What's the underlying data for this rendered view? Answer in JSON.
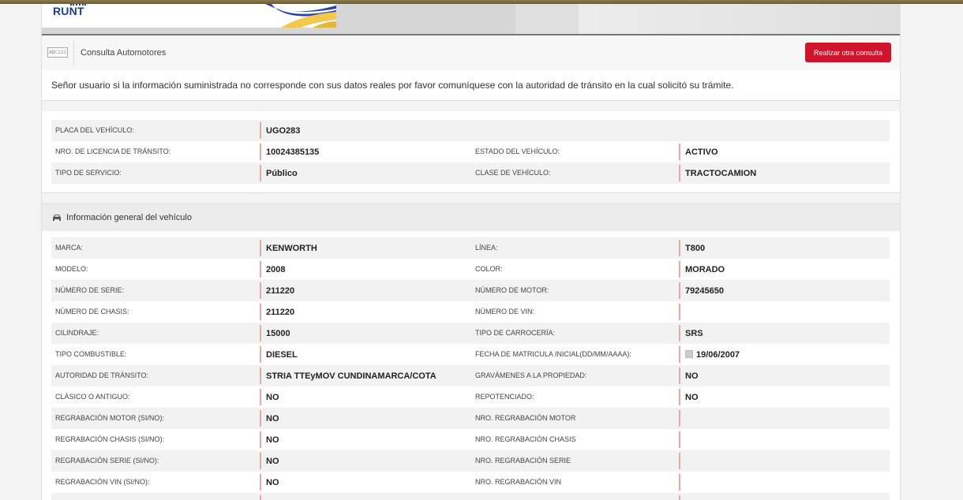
{
  "header": {
    "logo_text": "RUNT",
    "module_title": "Consulta Automotores",
    "plate_icon_text": "ABC123",
    "action_button": "Realizar otra consulta"
  },
  "notice": "Señor usuario si la información suministrada no corresponde con sus datos reales por favor comuníquese con la autoridad de tránsito en la cual solicitó su trámite.",
  "summary": {
    "rows": [
      {
        "label1": "PLACA DEL VEHÍCULO:",
        "value1": "UGO283",
        "label2": "",
        "value2": ""
      },
      {
        "label1": "NRO. DE LICENCIA DE TRÁNSITO:",
        "value1": "10024385135",
        "label2": "ESTADO DEL VEHÍCULO:",
        "value2": "ACTIVO"
      },
      {
        "label1": "TIPO DE SERVICIO:",
        "value1": "Público",
        "label2": "CLASE DE VEHÍCULO:",
        "value2": "TRACTOCAMION"
      }
    ]
  },
  "general": {
    "title": "Información general del vehículo",
    "icon": "car-icon",
    "rows": [
      {
        "label1": "MARCA:",
        "value1": "KENWORTH",
        "label2": "LÍNEA:",
        "value2": "T800"
      },
      {
        "label1": "MODELO:",
        "value1": "2008",
        "label2": "COLOR:",
        "value2": "MORADO"
      },
      {
        "label1": "NÚMERO DE SERIE:",
        "value1": "211220",
        "label2": "NÚMERO DE MOTOR:",
        "value2": "79245650"
      },
      {
        "label1": "NÚMERO DE CHASIS:",
        "value1": "211220",
        "label2": "NÚMERO DE VIN:",
        "value2": ""
      },
      {
        "label1": "CILINDRAJE:",
        "value1": "15000",
        "label2": "TIPO DE CARROCERÍA:",
        "value2": "SRS"
      },
      {
        "label1": "TIPO COMBUSTIBLE:",
        "value1": "DIESEL",
        "label2": "FECHA DE MATRICULA INICIAL(DD/MM/AAAA):",
        "value2": "19/06/2007"
      },
      {
        "label1": "AUTORIDAD DE TRÁNSITO:",
        "value1": "STRIA TTEyMOV CUNDINAMARCA/COTA",
        "label2": "GRAVÁMENES A LA PROPIEDAD:",
        "value2": "NO"
      },
      {
        "label1": "CLÁSICO O ANTIGUO:",
        "value1": "NO",
        "label2": "REPOTENCIADO:",
        "value2": "NO"
      },
      {
        "label1": "REGRABACIÓN MOTOR (SI/NO):",
        "value1": "NO",
        "label2": "NRO. REGRABACIÓN MOTOR",
        "value2": ""
      },
      {
        "label1": "REGRABACIÓN CHASIS (SI/NO):",
        "value1": "NO",
        "label2": "NRO. REGRABACIÓN CHASIS",
        "value2": ""
      },
      {
        "label1": "REGRABACIÓN SERIE (SI/NO):",
        "value1": "NO",
        "label2": "NRO. REGRABACIÓN SERIE",
        "value2": ""
      },
      {
        "label1": "REGRABACIÓN VIN (SI/NO):",
        "value1": "NO",
        "label2": "NRO. REGRABACIÓN VIN",
        "value2": ""
      },
      {
        "label1": "",
        "value1": "",
        "label2": "",
        "value2": ""
      }
    ]
  },
  "colors": {
    "accent_red": "#d0142c",
    "value_border": "#e6a9a9"
  }
}
